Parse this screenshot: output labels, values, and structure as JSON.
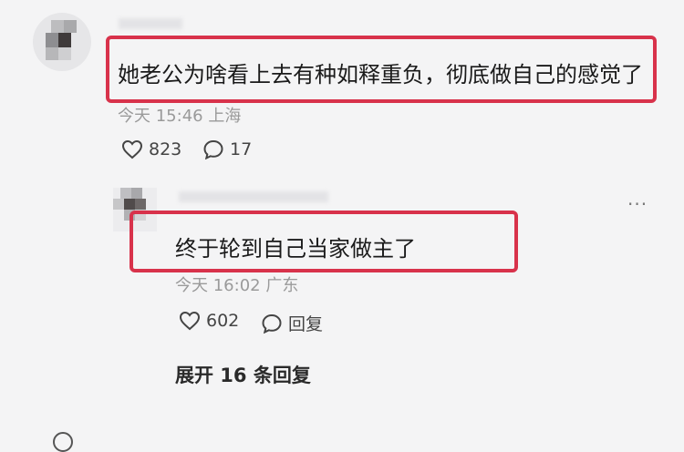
{
  "comment": {
    "text": "她老公为啥看上去有种如释重负，彻底做自己的感觉了",
    "time": "今天 15:46",
    "location": "上海",
    "likes": "823",
    "replies": "17"
  },
  "reply": {
    "text": "终于轮到自己当家做主了",
    "time": "今天 16:02",
    "location": "广东",
    "likes": "602",
    "reply_label": "回复",
    "more_label": "···"
  },
  "expand_label": "展开 16 条回复",
  "colors": {
    "highlight_border": "#d8324b",
    "background": "#f4f4f5",
    "meta_text": "#9a9a9a"
  },
  "icons": {
    "like": "heart-outline-icon",
    "comment": "speech-bubble-icon",
    "more": "more-dots-icon"
  }
}
